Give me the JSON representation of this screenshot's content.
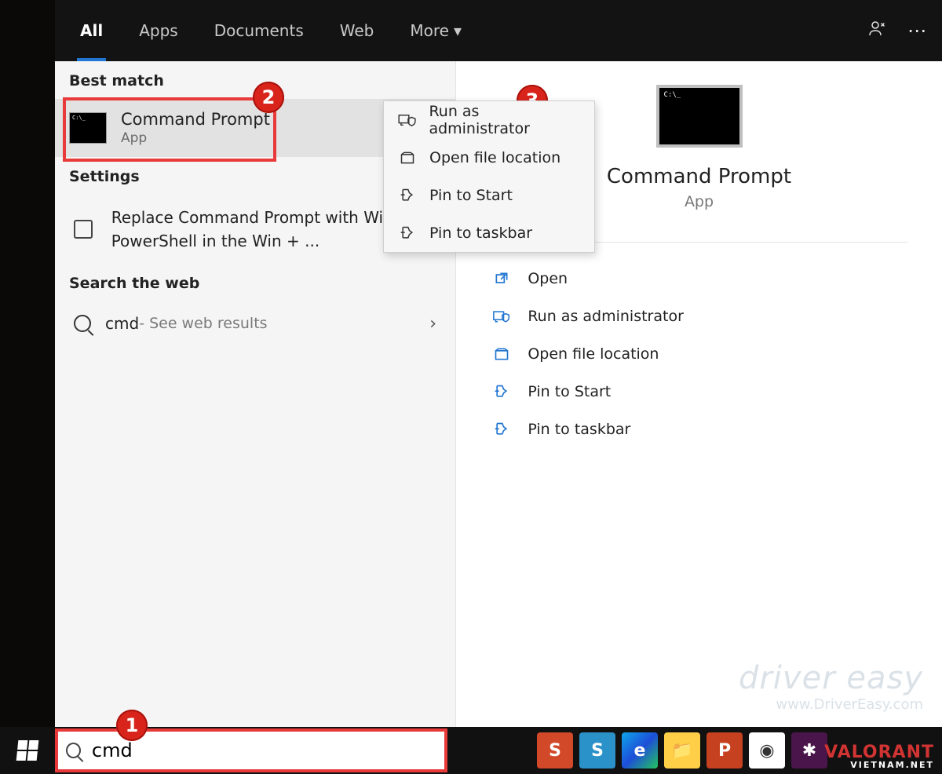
{
  "tabs": {
    "all": "All",
    "apps": "Apps",
    "documents": "Documents",
    "web": "Web",
    "more": "More"
  },
  "left": {
    "best_match_label": "Best match",
    "cmd_title": "Command Prompt",
    "cmd_sub": "App",
    "settings_label": "Settings",
    "settings_text": "Replace Command Prompt with Windows PowerShell in the Win + ...",
    "search_web_label": "Search the web",
    "web_term": "cmd",
    "web_hint": " - See web results"
  },
  "ctx": {
    "run_admin": "Run as administrator",
    "open_loc": "Open file location",
    "pin_start": "Pin to Start",
    "pin_taskbar": "Pin to taskbar"
  },
  "detail": {
    "name": "Command Prompt",
    "kind": "App",
    "open": "Open",
    "run_admin": "Run as administrator",
    "open_loc": "Open file location",
    "pin_start": "Pin to Start",
    "pin_taskbar": "Pin to taskbar"
  },
  "taskbar": {
    "search_value": "cmd"
  },
  "watermark": {
    "brand": "driver easy",
    "url": "www.DriverEasy.com"
  },
  "annotations": {
    "b1": "1",
    "b2": "2",
    "b3": "3"
  },
  "valo": {
    "brand": "VALORANT",
    "sub": "VIETNAM.NET"
  },
  "tray_colors": {
    "snagit": "#d2492a",
    "snagit2": "#2a91c9",
    "edge": "#1a73e8",
    "explorer": "#ffcf48",
    "ppt": "#c64120",
    "chrome": "#fff",
    "slack": "#4a154b"
  }
}
